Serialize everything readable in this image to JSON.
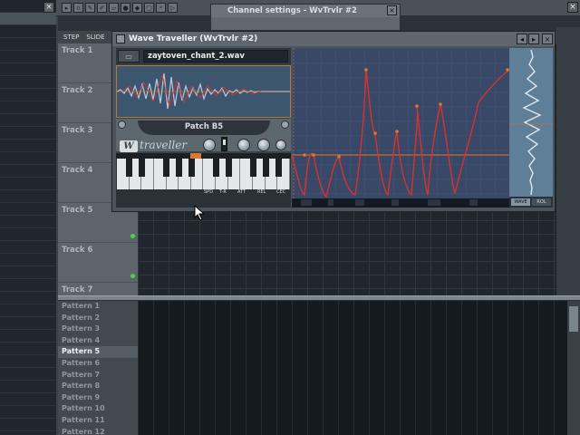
{
  "playlist": {
    "header_buttons": [
      "STEP",
      "SLIDE"
    ],
    "tracks": [
      "Track 1",
      "Track 2",
      "Track 3",
      "Track 4",
      "Track 5",
      "Track 6",
      "Track 7"
    ]
  },
  "patterns": {
    "items": [
      "Pattern 1",
      "Pattern 2",
      "Pattern 3",
      "Pattern 4",
      "Pattern 5",
      "Pattern 6",
      "Pattern 7",
      "Pattern 8",
      "Pattern 9",
      "Pattern 10",
      "Pattern 11",
      "Pattern 12"
    ],
    "active": "Pattern 5"
  },
  "channel_settings": {
    "title": "Channel settings - WvTrvlr #2"
  },
  "plugin": {
    "title": "Wave Traveller (WvTrvlr #2)",
    "filename": "zaytoven_chant_2.wav",
    "patch": "Patch B5",
    "logo_text": "traveller",
    "logo_letter": "W",
    "knobs": [
      "SPD",
      "T-R",
      "ATT",
      "REL",
      "CEC"
    ],
    "wave_buttons": [
      "WAVE",
      "ROL"
    ],
    "accent_color": "#e0762b",
    "curve_color": "#d8322f"
  }
}
